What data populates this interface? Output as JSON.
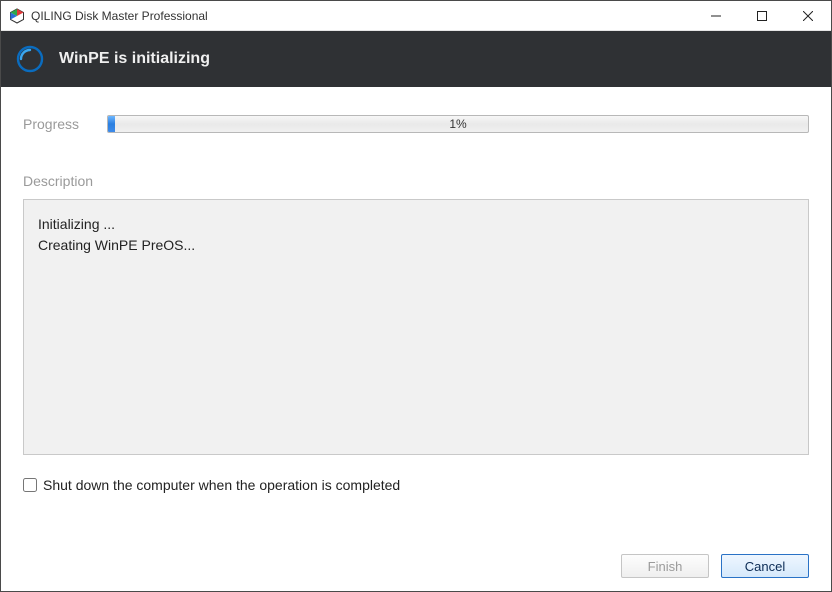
{
  "titlebar": {
    "app_title": "QILING Disk Master Professional"
  },
  "header": {
    "task_title": "WinPE is initializing"
  },
  "progress": {
    "label": "Progress",
    "percent_text": "1%",
    "percent_value": 1
  },
  "description": {
    "label": "Description",
    "lines": "Initializing ...\nCreating WinPE PreOS..."
  },
  "options": {
    "shutdown_label": "Shut down the computer when the operation is completed",
    "shutdown_checked": false
  },
  "footer": {
    "finish_label": "Finish",
    "cancel_label": "Cancel"
  },
  "colors": {
    "header_bg": "#2f3134",
    "progress_fill_top": "#6db6ff",
    "progress_fill_bottom": "#2b7fe0",
    "label_gray": "#9a9a9a"
  }
}
